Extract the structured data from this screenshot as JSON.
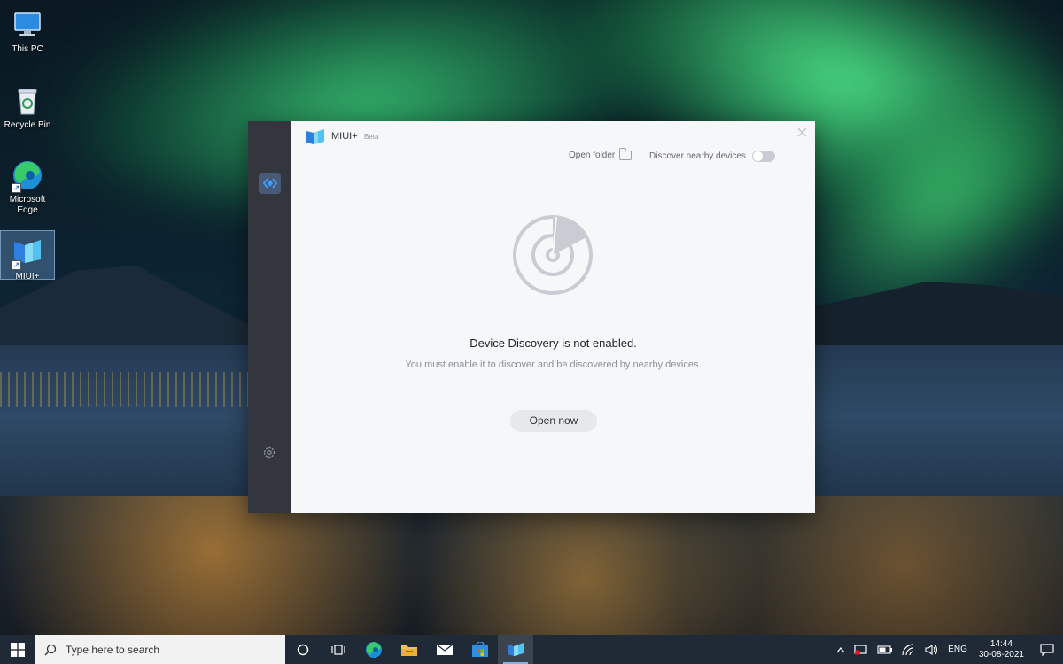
{
  "desktop": {
    "icons": [
      {
        "label": "This PC",
        "icon": "this-pc-icon"
      },
      {
        "label": "Recycle Bin",
        "icon": "recycle-bin-icon"
      },
      {
        "label": "Microsoft Edge",
        "icon": "edge-icon"
      },
      {
        "label": "MIUI+",
        "icon": "miui-plus-icon"
      }
    ]
  },
  "window": {
    "app_name": "MIUI+",
    "badge": "Beta",
    "open_folder_label": "Open folder",
    "discover_label": "Discover nearby devices",
    "discover_enabled": false,
    "message_title": "Device Discovery is not enabled.",
    "message_subtitle": "You must enable it to discover and be discovered by nearby devices.",
    "open_now_label": "Open now",
    "colors": {
      "sidebar": "#33363d",
      "accent": "#485a78",
      "background": "#f6f7f9"
    }
  },
  "taskbar": {
    "search_placeholder": "Type here to search",
    "apps": [
      "task-view",
      "edge",
      "file-explorer",
      "mail",
      "store",
      "miui-plus"
    ],
    "language": "ENG",
    "time": "14:44",
    "date": "30-08-2021"
  }
}
